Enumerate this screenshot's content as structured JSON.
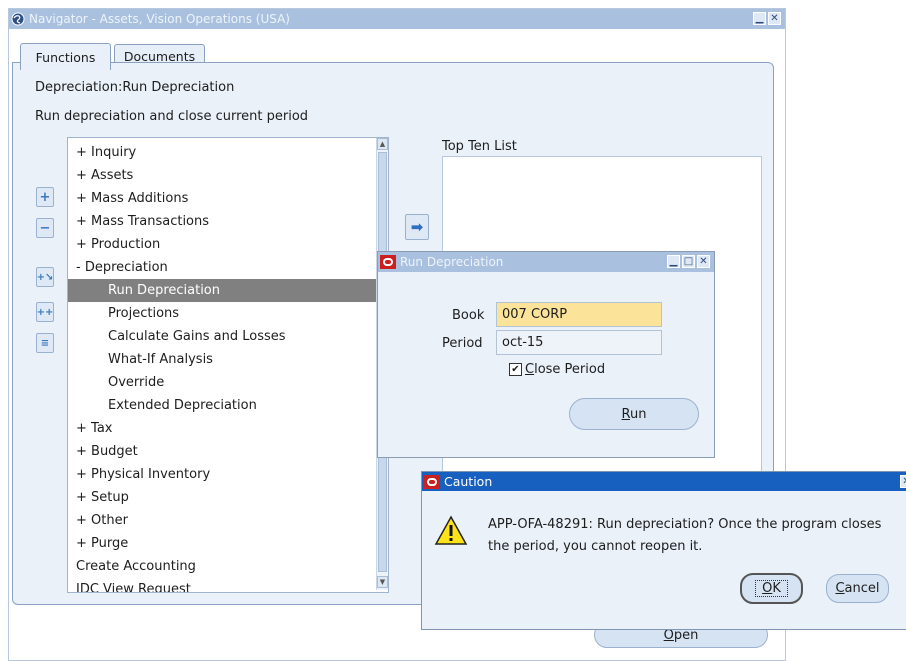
{
  "navigator": {
    "title": "Navigator - Assets, Vision Operations (USA)",
    "tabs": [
      {
        "label": "Functions"
      },
      {
        "label": "Documents"
      }
    ],
    "function_path": "Depreciation:Run Depreciation",
    "function_description": "Run depreciation and close current period",
    "tree_items": [
      {
        "label": "+ Inquiry"
      },
      {
        "label": "+ Assets"
      },
      {
        "label": "+ Mass Additions"
      },
      {
        "label": "+ Mass Transactions"
      },
      {
        "label": "+ Production"
      },
      {
        "label": "- Depreciation"
      },
      {
        "label": "Run Depreciation"
      },
      {
        "label": "Projections"
      },
      {
        "label": "Calculate Gains and Losses"
      },
      {
        "label": "What-If Analysis"
      },
      {
        "label": "Override"
      },
      {
        "label": "Extended Depreciation"
      },
      {
        "label": "+ Tax"
      },
      {
        "label": "+ Budget"
      },
      {
        "label": "+ Physical Inventory"
      },
      {
        "label": "+ Setup"
      },
      {
        "label": "+ Other"
      },
      {
        "label": "+ Purge"
      },
      {
        "label": "Create Accounting"
      },
      {
        "label": "IDC View Request"
      }
    ],
    "selected_item": "Run Depreciation",
    "top_ten_label": "Top Ten List",
    "open_button": "Open",
    "open_mnemonic": "O",
    "open_rest": "pen"
  },
  "run_dialog": {
    "title": "Run Depreciation",
    "book_label": "Book",
    "book_value": "007 CORP",
    "period_label": "Period",
    "period_value": "oct-15",
    "close_period_mnemonic": "C",
    "close_period_rest": "lose Period",
    "close_period_checked": true,
    "run_mnemonic": "R",
    "run_rest": "un"
  },
  "caution_dialog": {
    "title": "Caution",
    "message_line1": "APP-OFA-48291: Run depreciation?  Once the program closes",
    "message_line2": "the period, you cannot reopen it.",
    "ok_mnemonic": "O",
    "ok_rest": "K",
    "cancel_mnemonic": "C",
    "cancel_rest": "ancel"
  },
  "colors": {
    "inactive_titlebar": "#a9c1df",
    "active_titlebar": "#1760c0",
    "selected_item": "#808080",
    "book_field_bg": "#fbe49a",
    "panel_bg": "#eaf1f9"
  }
}
